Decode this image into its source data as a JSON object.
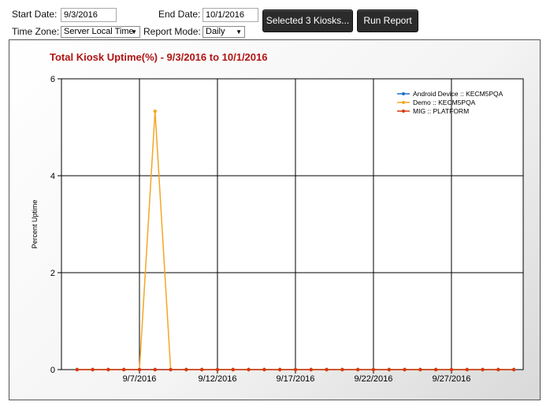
{
  "filters": {
    "start_date_label": "Start Date:",
    "start_date_value": "9/3/2016",
    "end_date_label": "End Date:",
    "end_date_value": "10/1/2016",
    "time_zone_label": "Time Zone:",
    "time_zone_value": "Server Local Time",
    "report_mode_label": "Report Mode:",
    "report_mode_value": "Daily"
  },
  "buttons": {
    "select_kiosks": "Selected 3 Kiosks...",
    "run_report": "Run Report"
  },
  "chart_data": {
    "type": "line",
    "title": "Total Kiosk Uptime(%) - 9/3/2016 to 10/1/2016",
    "xlabel": "",
    "ylabel": "Percent Uptime",
    "ylim": [
      0,
      6
    ],
    "yticks": [
      0,
      2,
      4,
      6
    ],
    "x": [
      "9/3/2016",
      "9/4/2016",
      "9/5/2016",
      "9/6/2016",
      "9/7/2016",
      "9/8/2016",
      "9/9/2016",
      "9/10/2016",
      "9/11/2016",
      "9/12/2016",
      "9/13/2016",
      "9/14/2016",
      "9/15/2016",
      "9/16/2016",
      "9/17/2016",
      "9/18/2016",
      "9/19/2016",
      "9/20/2016",
      "9/21/2016",
      "9/22/2016",
      "9/23/2016",
      "9/24/2016",
      "9/25/2016",
      "9/26/2016",
      "9/27/2016",
      "9/28/2016",
      "9/29/2016",
      "9/30/2016",
      "10/1/2016"
    ],
    "xtick_labels": [
      "9/7/2016",
      "9/12/2016",
      "9/17/2016",
      "9/22/2016",
      "9/27/2016"
    ],
    "grid": true,
    "legend_position": "top-right",
    "series": [
      {
        "name": "Android Device :: KECM5PQA",
        "color": "#1f6fd1",
        "values": [
          0,
          0,
          0,
          0,
          0,
          0,
          0,
          0,
          0,
          0,
          0,
          0,
          0,
          0,
          0,
          0,
          0,
          0,
          0,
          0,
          0,
          0,
          0,
          0,
          0,
          0,
          0,
          0,
          0
        ]
      },
      {
        "name": "Demo :: KECM5PQA",
        "color": "#f5a623",
        "values": [
          0,
          0,
          0,
          0,
          0,
          5.33,
          0,
          0,
          0,
          0,
          0,
          0,
          0,
          0,
          0,
          0,
          0,
          0,
          0,
          0,
          0,
          0,
          0,
          0,
          0,
          0,
          0,
          0,
          0
        ]
      },
      {
        "name": "MIG :: PLATFORM",
        "color": "#d63a10",
        "values": [
          0,
          0,
          0,
          0,
          0,
          0,
          0,
          0,
          0,
          0,
          0,
          0,
          0,
          0,
          0,
          0,
          0,
          0,
          0,
          0,
          0,
          0,
          0,
          0,
          0,
          0,
          0,
          0,
          0
        ]
      }
    ]
  }
}
